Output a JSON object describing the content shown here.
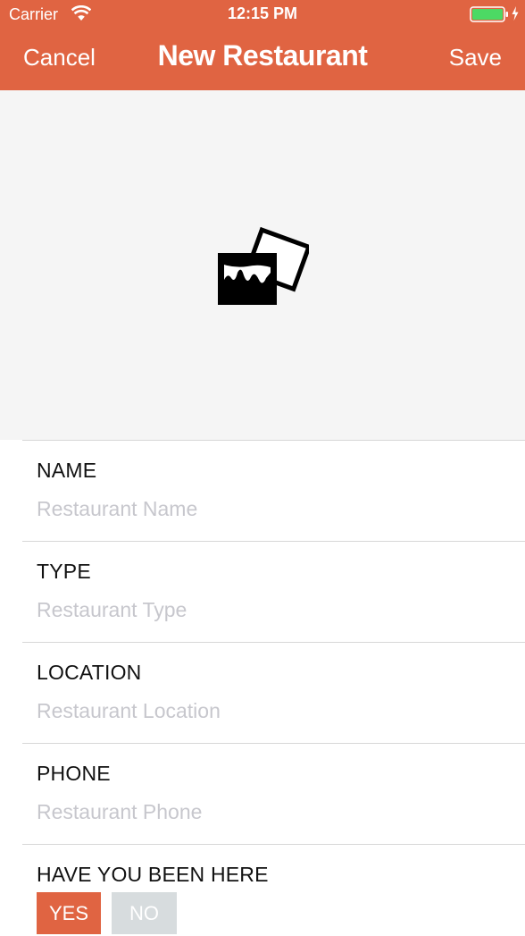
{
  "status_bar": {
    "carrier": "Carrier",
    "time": "12:15 PM",
    "icons": [
      "wifi-icon",
      "battery-icon",
      "charging-bolt-icon"
    ]
  },
  "nav": {
    "cancel_label": "Cancel",
    "title": "New Restaurant",
    "save_label": "Save"
  },
  "photo": {
    "icon": "photo-icon"
  },
  "fields": [
    {
      "label": "NAME",
      "placeholder": "Restaurant Name"
    },
    {
      "label": "TYPE",
      "placeholder": "Restaurant Type"
    },
    {
      "label": "LOCATION",
      "placeholder": "Restaurant Location"
    },
    {
      "label": "PHONE",
      "placeholder": "Restaurant Phone"
    }
  ],
  "visited": {
    "label": "HAVE YOU BEEN HERE",
    "yes_label": "YES",
    "no_label": "NO",
    "selected": "YES"
  },
  "colors": {
    "accent": "#E06442",
    "photo_background": "#F5F5F5",
    "placeholder": "#C7C7CD",
    "no_button": "#D7DCDE",
    "battery": "#4CD964"
  }
}
